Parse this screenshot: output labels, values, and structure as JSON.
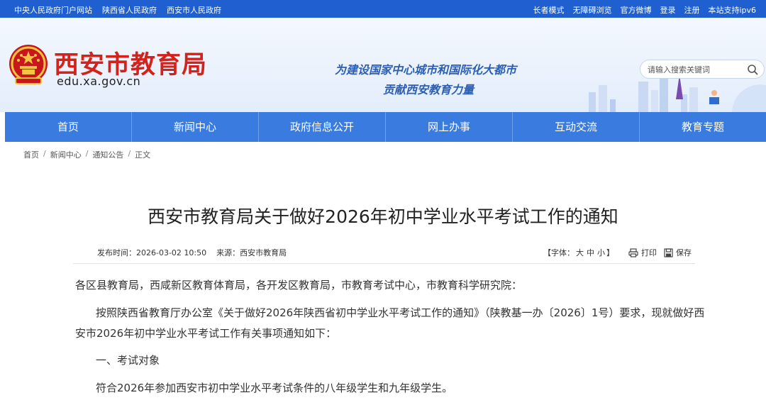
{
  "topbar": {
    "left_links": [
      "中央人民政府门户网站",
      "陕西省人民政府",
      "西安市人民政府"
    ],
    "right_links": [
      "长者模式",
      "无障碍浏览",
      "官方微博",
      "登录",
      "注册",
      "本站支持ipv6"
    ]
  },
  "header": {
    "site_title": "西安市教育局",
    "domain": "edu.xa.gov.cn",
    "slogan_line1": "为建设国家中心城市和国际化大都市",
    "slogan_line2": "贡献西安教育力量",
    "search_placeholder": "请输入搜索关键词"
  },
  "nav": {
    "items": [
      "首页",
      "新闻中心",
      "政府信息公开",
      "网上办事",
      "互动交流",
      "教育专题"
    ]
  },
  "breadcrumb": [
    "首页",
    "新闻中心",
    "通知公告",
    "正文"
  ],
  "article": {
    "title": "西安市教育局关于做好2026年初中学业水平考试工作的通知",
    "publish_label": "发布时间：2026-03-02 10:50",
    "source_label": "来源：西安市教育局",
    "font_size_prefix": "【字体：",
    "font_sizes": [
      "大",
      "中",
      "小"
    ],
    "font_size_suffix": "】",
    "print_label": "打印",
    "save_label": "保存",
    "paragraphs": [
      "各区县教育局，西咸新区教育体育局，各开发区教育局，市教育考试中心，市教育科学研究院：",
      "按照陕西省教育厅办公室《关于做好2026年陕西省初中学业水平考试工作的通知》（陕教基一办〔2026〕1号）要求，现就做好西",
      "安市2026年初中学业水平考试工作有关事项通知如下：",
      "一、考试对象",
      "符合2026年参加西安市初中学业水平考试条件的八年级学生和九年级学生。"
    ]
  },
  "colors": {
    "topbar": "#1f5fd0",
    "nav": "#3a7be0",
    "title_red": "#d2221b",
    "slogan_blue": "#2c5fb4"
  }
}
